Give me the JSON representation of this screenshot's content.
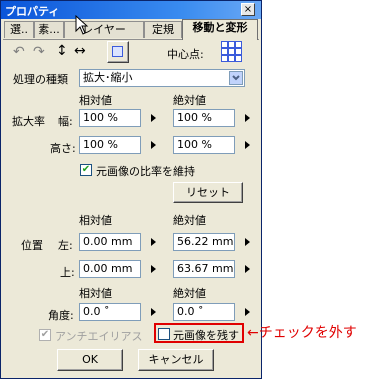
{
  "window": {
    "title": "プロパティ",
    "close": "×"
  },
  "tabs": [
    "選..",
    "素...",
    "レイヤー",
    "定規",
    "移動と変形"
  ],
  "toolbar": {
    "undo_icon": "↶",
    "redo_icon": "↷",
    "vertical_icon": "↕",
    "horizontal_icon": "↔",
    "center_label": "中心点:"
  },
  "process": {
    "label": "処理の種類",
    "value": "拡大･縮小"
  },
  "scale": {
    "label": "拡大率",
    "relative_header": "相対値",
    "absolute_header": "絶対値",
    "width_label": "幅:",
    "height_label": "高さ:",
    "width_relative": "100 %",
    "width_absolute": "100 %",
    "height_relative": "100 %",
    "height_absolute": "100 %",
    "keep_ratio_label": "元画像の比率を維持",
    "keep_ratio_checked": true,
    "reset_label": "リセット"
  },
  "position": {
    "label": "位置",
    "relative_header": "相対値",
    "absolute_header": "絶対値",
    "left_label": "左:",
    "top_label": "上:",
    "left_relative": "0.00 mm",
    "left_absolute": "56.22 mm",
    "top_relative": "0.00 mm",
    "top_absolute": "63.67 mm"
  },
  "angle": {
    "relative_header": "相対値",
    "absolute_header": "絶対値",
    "label": "角度:",
    "relative": "0.0 ˚",
    "absolute": "0.0 ˚"
  },
  "options": {
    "antialias_label": "アンチエイリアス",
    "antialias_checked": true,
    "keep_original_label": "元画像を残す",
    "keep_original_checked": false
  },
  "buttons": {
    "ok": "OK",
    "cancel": "キャンセル"
  },
  "annotation": {
    "text": "←チェックを外す",
    "color": "#e00000"
  }
}
